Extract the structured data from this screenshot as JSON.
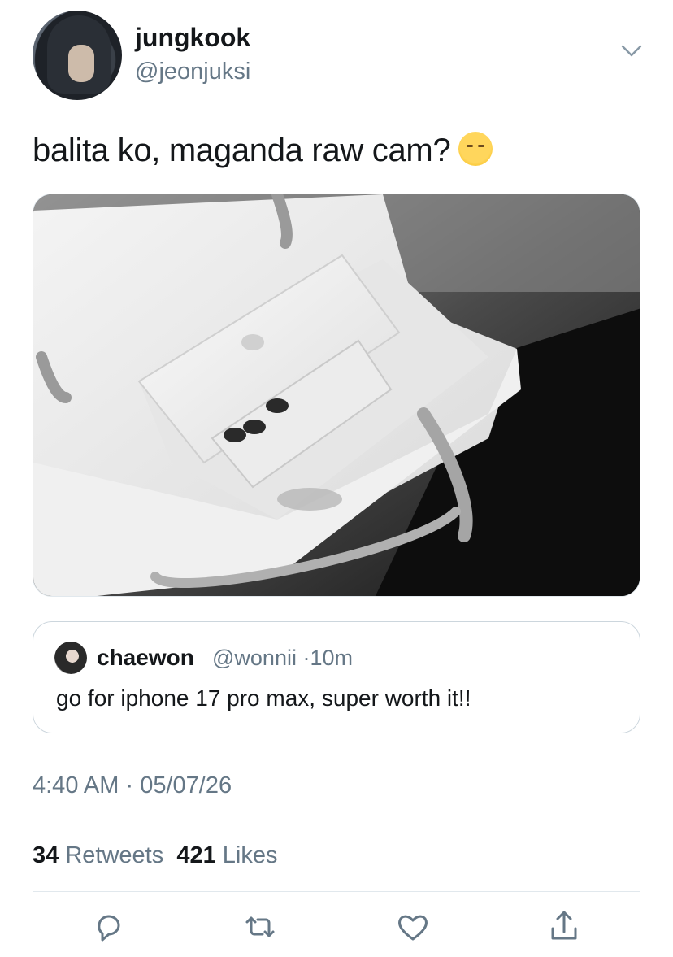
{
  "author": {
    "name": "jungkook",
    "handle": "@jeonjuksi"
  },
  "tweet": {
    "text": "balita ko, maganda raw cam?"
  },
  "quoted": {
    "name": "chaewon",
    "handle": "@wonnii",
    "sep": "·",
    "time": "10m",
    "text": "go for iphone 17 pro max, super worth it!!"
  },
  "meta": {
    "time": "4:40 AM",
    "sep": "·",
    "date": "05/07/26"
  },
  "stats": {
    "retweets_count": "34",
    "retweets_label": "Retweets",
    "likes_count": "421",
    "likes_label": "Likes"
  },
  "icons": {
    "menu": "chevron-down-icon",
    "emoji": "face-exhaling-emoji",
    "actions": [
      "reply-icon",
      "retweet-icon",
      "like-icon",
      "share-icon"
    ]
  },
  "colors": {
    "text": "#14171a",
    "secondary": "#657786",
    "border": "#ccd6dd"
  }
}
